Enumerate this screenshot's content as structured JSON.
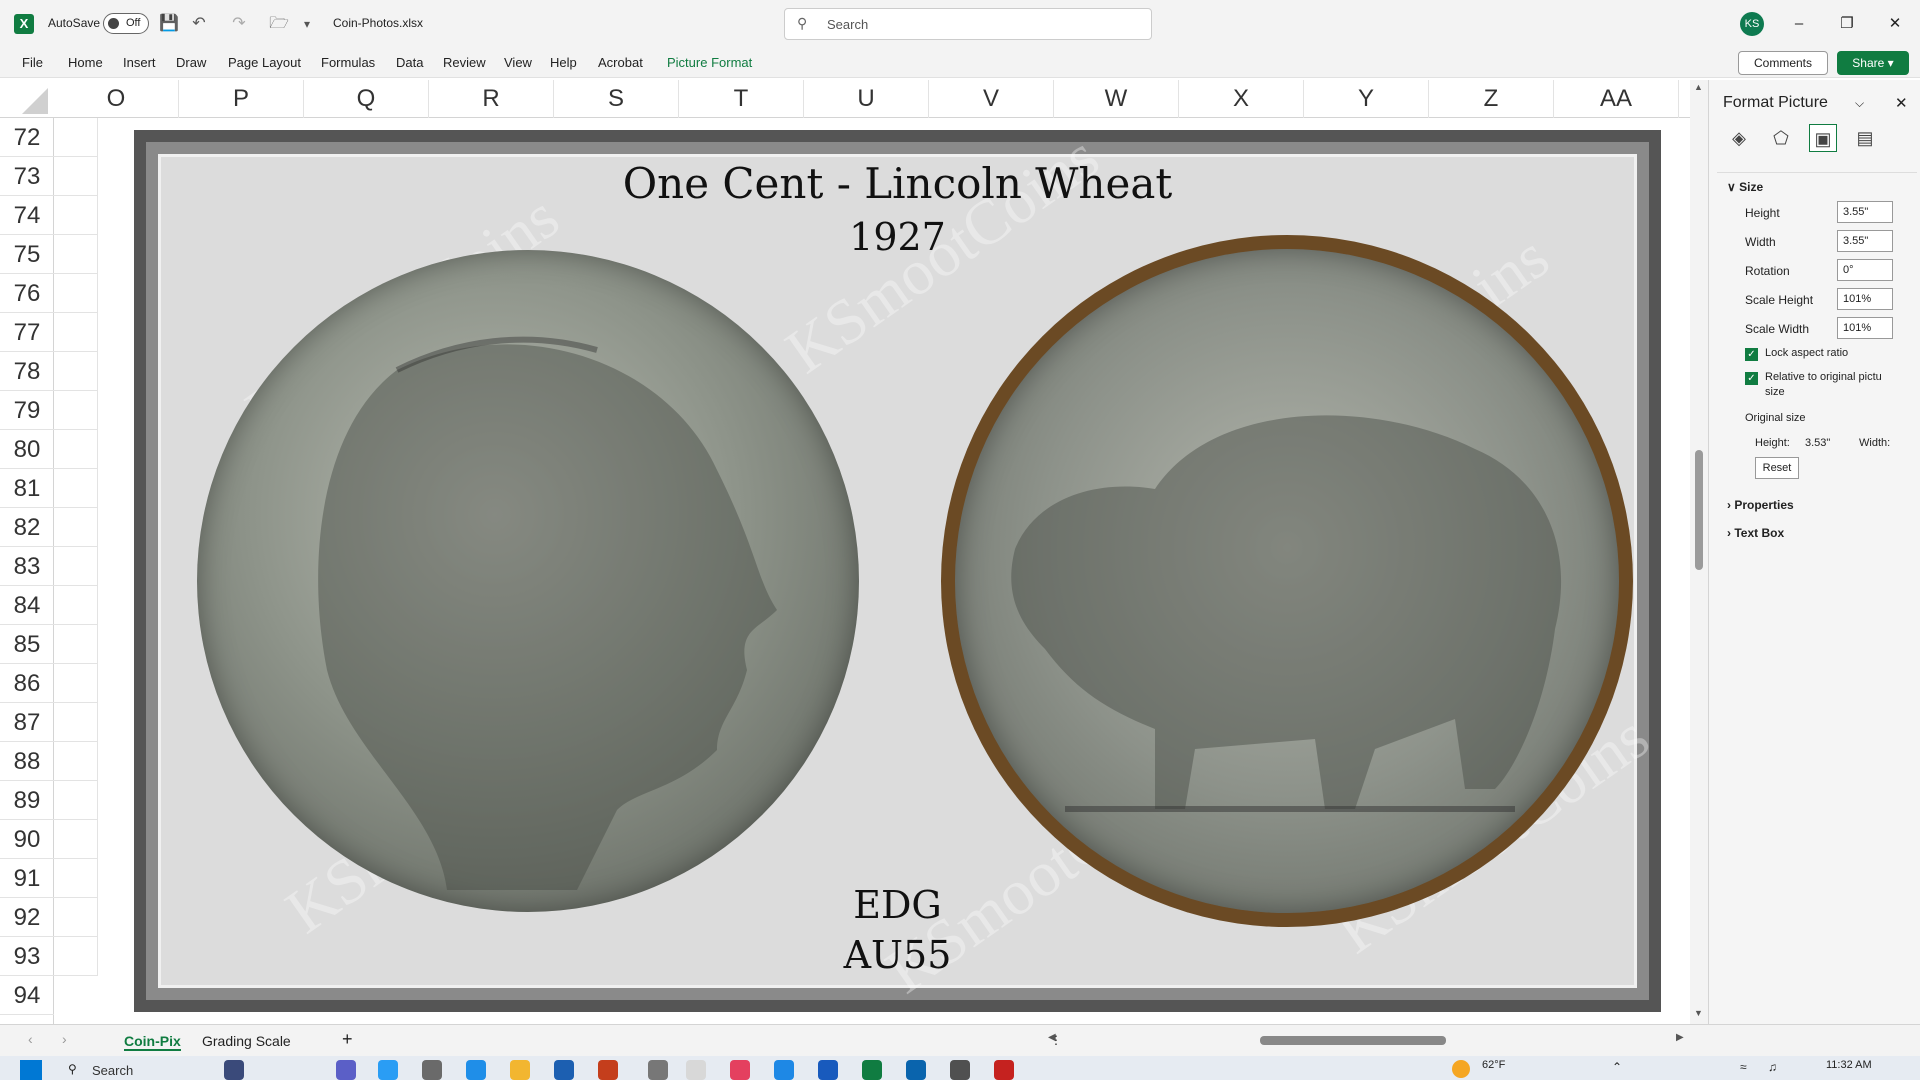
{
  "titlebar": {
    "autosave_label": "AutoSave",
    "autosave_state": "Off",
    "filename": "Coin-Photos.xlsx",
    "search_placeholder": "Search",
    "avatar": "KS"
  },
  "ribbon": {
    "tabs": [
      "File",
      "Home",
      "Insert",
      "Draw",
      "Page Layout",
      "Formulas",
      "Data",
      "Review",
      "View",
      "Help",
      "Acrobat",
      "Picture Format"
    ],
    "active_tab": "Picture Format",
    "comments": "Comments",
    "share": "Share"
  },
  "columns": [
    "O",
    "P",
    "Q",
    "R",
    "S",
    "T",
    "U",
    "V",
    "W",
    "X",
    "Y",
    "Z",
    "AA"
  ],
  "rows": [
    "72",
    "73",
    "74",
    "75",
    "76",
    "77",
    "78",
    "79",
    "80",
    "81",
    "82",
    "83",
    "84",
    "85",
    "86",
    "87",
    "88",
    "89",
    "90",
    "91",
    "92",
    "93",
    "94"
  ],
  "picture": {
    "title": "One Cent - Lincoln Wheat",
    "year": "1927",
    "grader": "EDG",
    "grade": "AU55",
    "watermark": "KSmootCoins"
  },
  "format_pane": {
    "title": "Format Picture",
    "size_section": "Size",
    "height_label": "Height",
    "height_value": "3.55\"",
    "width_label": "Width",
    "width_value": "3.55\"",
    "rotation_label": "Rotation",
    "rotation_value": "0°",
    "scale_height_label": "Scale Height",
    "scale_height_value": "101%",
    "scale_width_label": "Scale Width",
    "scale_width_value": "101%",
    "lock_label": "Lock aspect ratio",
    "relative_label": "Relative to original pictu",
    "relative_label2": "size",
    "original_size_label": "Original size",
    "orig_height_label": "Height:",
    "orig_height_value": "3.53\"",
    "orig_width_label": "Width:",
    "reset": "Reset",
    "properties": "Properties",
    "text_box": "Text Box"
  },
  "sheets": {
    "tabs": [
      "Coin-Pix",
      "Grading Scale"
    ],
    "active": "Coin-Pix"
  },
  "taskbar": {
    "search": "Search",
    "weather": "62°F",
    "time": "11:32 AM"
  }
}
